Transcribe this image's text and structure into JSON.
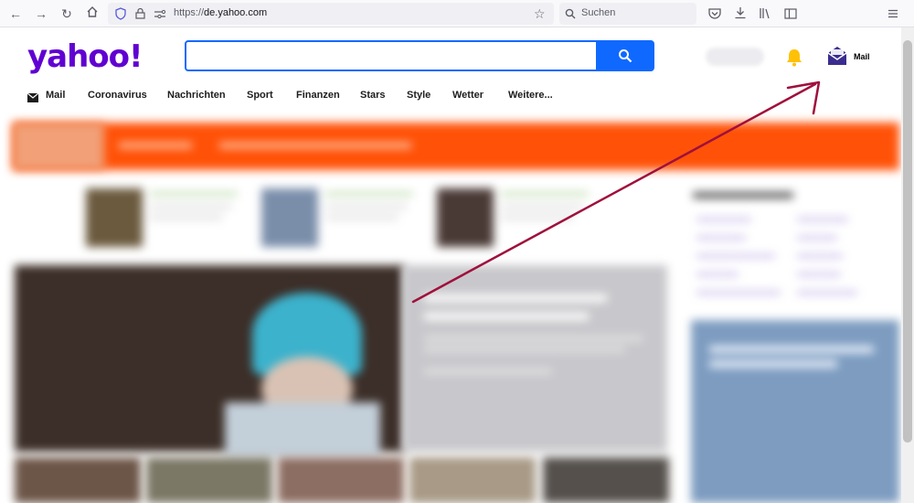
{
  "browser": {
    "url_prefix": "https://",
    "url_domain": "de.yahoo.com",
    "search_placeholder": "Suchen"
  },
  "yahoo": {
    "logo_text": "yahoo!",
    "search_button_icon": "search-icon",
    "bell_icon": "bell-icon",
    "mail_icon": "envelope-icon",
    "mail_label": "Mail",
    "nav": [
      "Mail",
      "Coronavirus",
      "Nachrichten",
      "Sport",
      "Finanzen",
      "Stars",
      "Style",
      "Wetter",
      "Weitere..."
    ]
  },
  "colors": {
    "brand": "#6001d2",
    "search_blue": "#0f69ff",
    "banner": "#ff5208",
    "bell": "#ffc107",
    "arrow": "#a0103c"
  }
}
